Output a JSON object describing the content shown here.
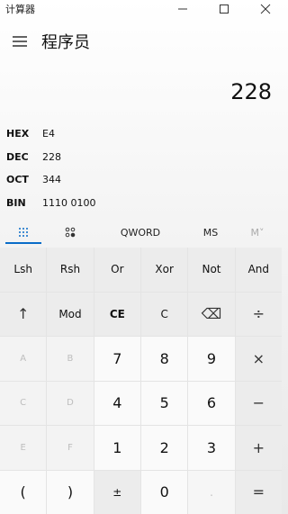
{
  "window": {
    "title": "计算器"
  },
  "header": {
    "mode_title": "程序员"
  },
  "display": {
    "value": "228"
  },
  "radix": [
    {
      "label": "HEX",
      "value": "E4"
    },
    {
      "label": "DEC",
      "value": "228"
    },
    {
      "label": "OCT",
      "value": "344"
    },
    {
      "label": "BIN",
      "value": "1110 0100"
    }
  ],
  "toolbar": {
    "word_size": "QWORD",
    "ms": "MS",
    "mplus": "M˅"
  },
  "keys": {
    "lsh": "Lsh",
    "rsh": "Rsh",
    "or": "Or",
    "xor": "Xor",
    "not": "Not",
    "and": "And",
    "up": "↑",
    "mod": "Mod",
    "ce": "CE",
    "c": "C",
    "backspace": "⌫",
    "divide": "÷",
    "a": "A",
    "b": "B",
    "n7": "7",
    "n8": "8",
    "n9": "9",
    "multiply": "×",
    "c_hex": "C",
    "d": "D",
    "n4": "4",
    "n5": "5",
    "n6": "6",
    "minus": "−",
    "e": "E",
    "f": "F",
    "n1": "1",
    "n2": "2",
    "n3": "3",
    "plus": "+",
    "lparen": "(",
    "rparen": ")",
    "negate": "±",
    "n0": "0",
    "dot": ".",
    "equals": "="
  },
  "colors": {
    "accent": "#0a6cc8"
  }
}
